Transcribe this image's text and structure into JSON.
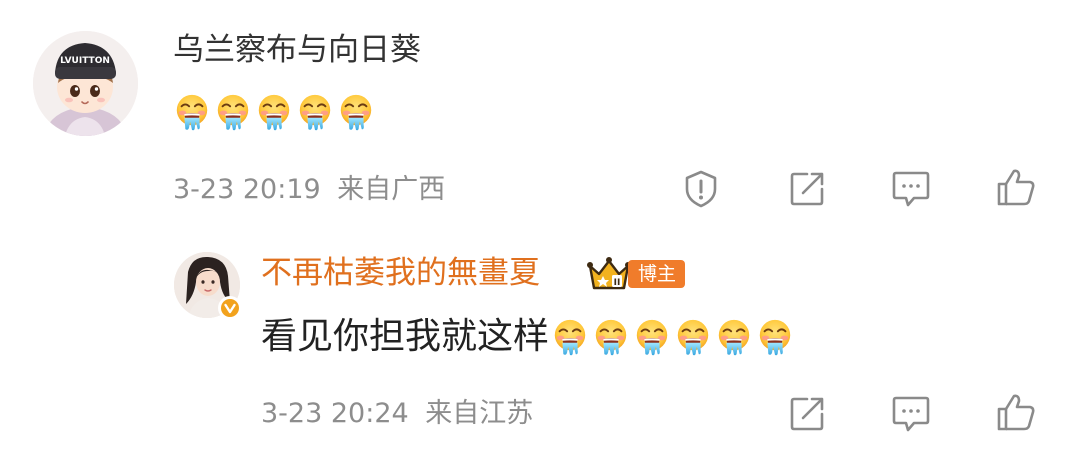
{
  "comment": {
    "username": "乌兰察布与向日葵",
    "emoji_names": [
      "drooling-emoji",
      "drooling-emoji",
      "drooling-emoji",
      "drooling-emoji",
      "drooling-emoji"
    ],
    "date": "3-23 20:19",
    "location": "来自广西",
    "actions": [
      "report-icon",
      "share-icon",
      "comment-icon",
      "like-icon"
    ]
  },
  "reply": {
    "username": "不再枯萎我的無畫夏",
    "badge": "博主",
    "crown_level": "II",
    "text": "看见你担我就这样",
    "emoji_names": [
      "drooling-emoji",
      "drooling-emoji",
      "drooling-emoji",
      "drooling-emoji",
      "drooling-emoji",
      "drooling-emoji"
    ],
    "date": "3-23 20:24",
    "location": "来自江苏",
    "actions": [
      "share-icon",
      "comment-icon",
      "like-icon"
    ]
  },
  "colors": {
    "username_main": "#333333",
    "username_reply": "#e0701e",
    "badge_bg": "#f07c2b",
    "meta_text": "#8d8d8d",
    "icon_stroke": "#8a8a8a"
  },
  "avatar_main_text": "LVUITTON"
}
